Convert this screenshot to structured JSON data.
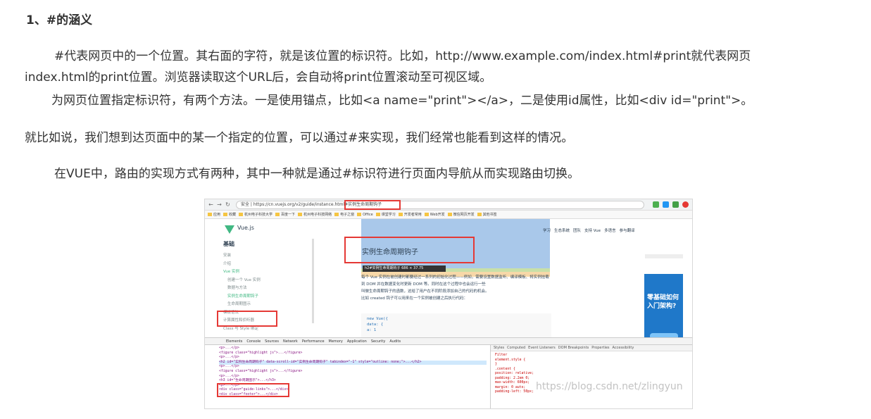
{
  "heading": "1、#的涵义",
  "paragraphs": {
    "p1_line1": "#代表网页中的一个位置。其右面的字符，就是该位置的标识符。比如，http://www.example.com/index.html#print就代表网页",
    "p1_line2": "index.html的print位置。浏览器读取这个URL后，会自动将print位置滚动至可视区域。",
    "p2": "为网页位置指定标识符，有两个方法。一是使用锚点，比如<a name=\"print\"></a>，二是使用id属性，比如<div id=\"print\">。",
    "p3": "就比如说，我们想到达页面中的某一个指定的位置，可以通过#来实现，我们经常也能看到这样的情况。",
    "p4": "在VUE中，路由的实现方式有两种，其中一种就是通过#标识符进行页面内导航从而实现路由切换。"
  },
  "screenshot": {
    "url": "安全 | https://cn.vuejs.org/v2/guide/instance.html#实例生命周期钩子",
    "bookmarks": [
      "应用",
      "收藏",
      "杭州电子科技大学",
      "百度一下",
      "杭州电子科技网络",
      "电子之窗",
      "Office",
      "课堂学习",
      "开发者常用",
      "Web开发",
      "微信网页开发",
      "其他书签"
    ],
    "logo_text": "Vue.js",
    "topnav": [
      "学习",
      "生态系统",
      "团队",
      "支持 Vue",
      "多语言",
      "参与翻译"
    ],
    "sidebar_title": "基础",
    "sidebar_items": [
      "安装",
      "介绍",
      "Vue 实例",
      "创建一个 Vue 实例",
      "数据与方法",
      "实例生命周期钩子",
      "生命周期图示",
      "模板语法",
      "计算属性和侦听器",
      "Class 与 Style 绑定"
    ],
    "section_title": "实例生命周期钩子",
    "tooltip": "h2#实例生命周期钩子  686 × 37.75",
    "content_lines": [
      "每个 Vue 实例在被创建时都要经过一系列的初始化过程——例如，需要设置数据监听、编译模板、将实例挂载到 DOM 并在数据变化时更新 DOM 等。同时在这个过程中也会运行一些",
      "叫做生命周期钩子的函数，这给了用户在不同阶段添加自己的代码的机会。",
      "比如 created 钩子可以用来在一个实例被创建之后执行代码："
    ],
    "code_lines": [
      "new Vue({",
      "  data: {",
      "    a: 1"
    ],
    "ad_text": "零基础如何入门架构?",
    "devtools_tabs": [
      "Elements",
      "Console",
      "Sources",
      "Network",
      "Performance",
      "Memory",
      "Application",
      "Security",
      "Audits"
    ],
    "dom_lines": [
      "<p>...</p>",
      "<figure class=\"highlight js\">...</figure>",
      "<p>...</p>",
      "<h2 id=\"实例生命周期钩子\" data-scroll-id=\"实例生命周期钩子\" tabindex=\"-1\" style=\"outline: none;\">...</h2>",
      "<p>...</p>",
      "<figure class=\"highlight js\">...</figure>",
      "<p>...</p>",
      "<h3 id=\"生命周期图示\">...</h3>",
      "<p>...</p>",
      "<div class=\"guide-links\">...</div>",
      "<div class=\"footer\">...</div>"
    ],
    "styles_tabs": [
      "Styles",
      "Computed",
      "Event Listeners",
      "DOM Breakpoints",
      "Properties",
      "Accessibility"
    ],
    "styles_lines": [
      "Filter",
      "element.style {",
      "}",
      ".content {",
      "  position: relative;",
      "  padding: 2.2em 0;",
      "  max-width: 600px;",
      "  margin: 0 auto;",
      "  padding-left: 50px;"
    ],
    "watermark": "https://blog.csdn.net/zlingyun"
  }
}
